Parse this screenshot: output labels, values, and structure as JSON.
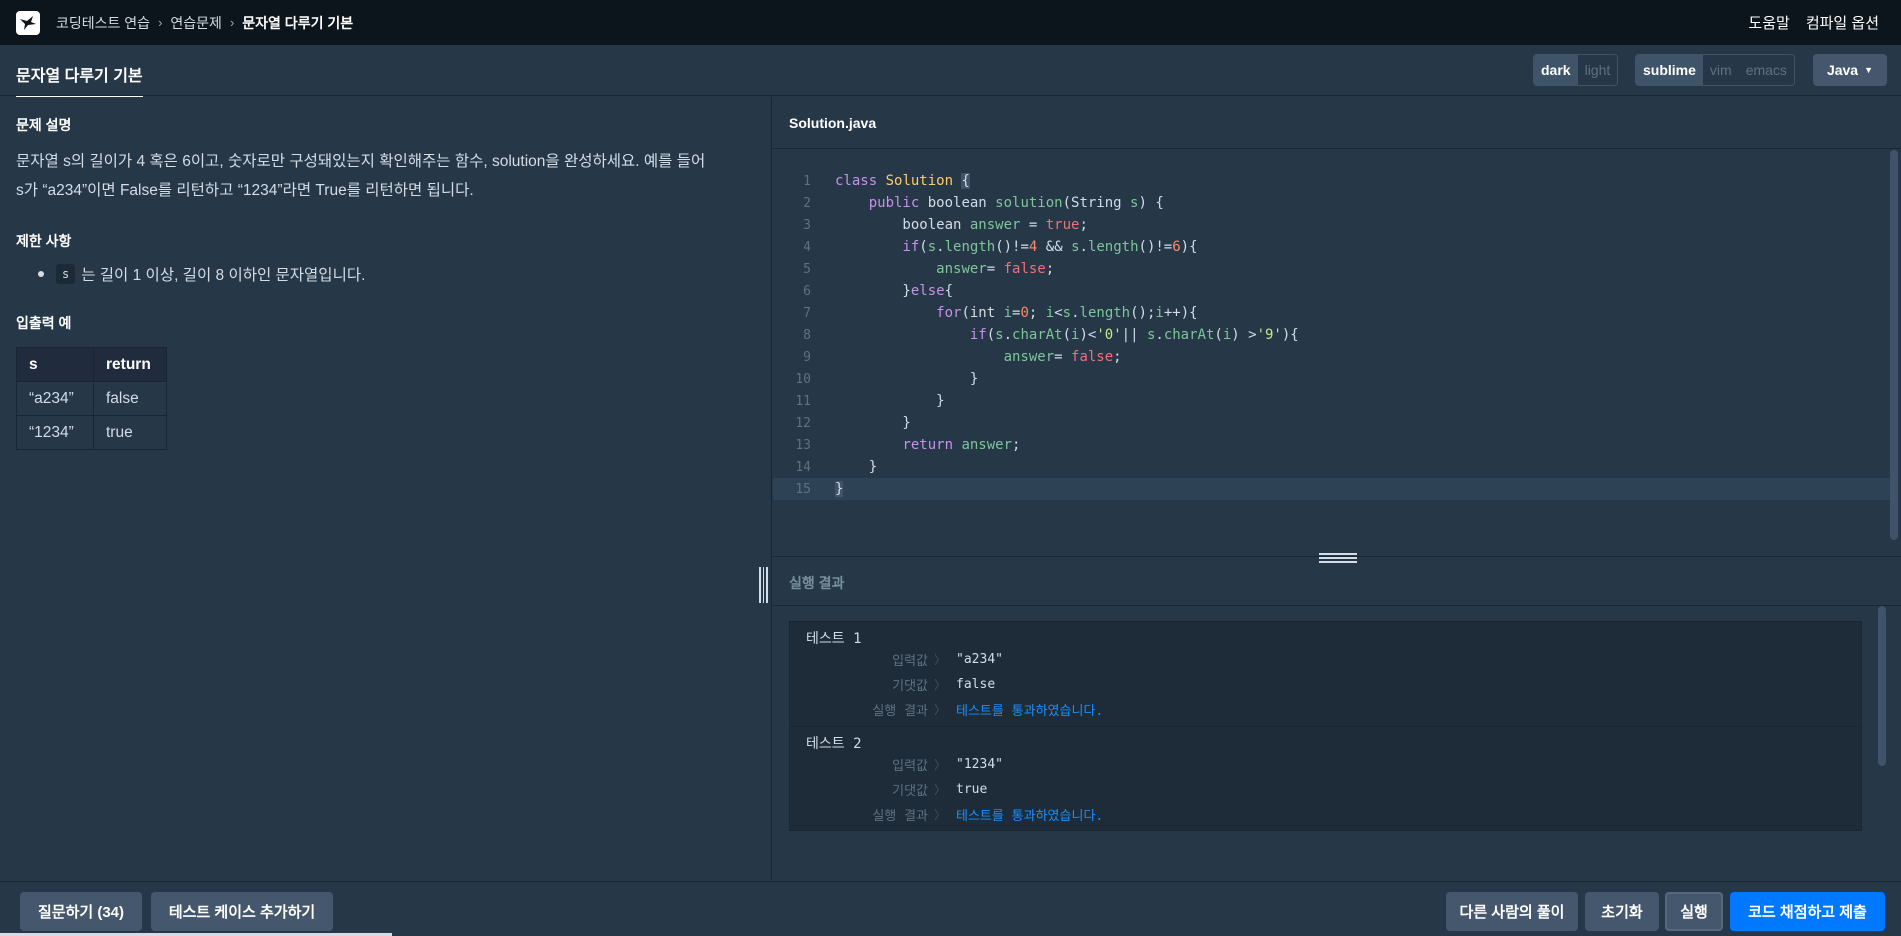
{
  "nav": {
    "breadcrumb": [
      "코딩테스트 연습",
      "연습문제",
      "문자열 다루기 기본"
    ],
    "help": "도움말",
    "compile_options": "컴파일 옵션"
  },
  "header": {
    "tab_title": "문자열 다루기 기본",
    "themes": [
      "dark",
      "light"
    ],
    "keymaps": [
      "sublime",
      "vim",
      "emacs"
    ],
    "language": "Java"
  },
  "problem": {
    "desc_heading": "문제 설명",
    "desc_line1": "문자열 s의 길이가 4 혹은 6이고, 숫자로만 구성돼있는지 확인해주는 함수, solution을 완성하세요. 예를 들어",
    "desc_line2": "s가 “a234”이면 False를 리턴하고 “1234”라면 True를 리턴하면 됩니다.",
    "constraints_heading": "제한 사항",
    "constraint_code": "s",
    "constraint_text": "는 길이 1 이상, 길이 8 이하인 문자열입니다.",
    "io_heading": "입출력 예",
    "io_headers": [
      "s",
      "return"
    ],
    "io_rows": [
      [
        "“a234”",
        "false"
      ],
      [
        "“1234”",
        "true"
      ]
    ]
  },
  "editor": {
    "filename": "Solution.java",
    "line_numbers": [
      "1",
      "2",
      "3",
      "4",
      "5",
      "6",
      "7",
      "8",
      "9",
      "10",
      "11",
      "12",
      "13",
      "14",
      "15"
    ]
  },
  "result": {
    "heading": "실행 결과",
    "tests": [
      {
        "name": "테스트 1",
        "input_label": "입력값",
        "input": "\"a234\"",
        "expected_label": "기댓값",
        "expected": "false",
        "result_label": "실행 결과",
        "result": "테스트를 통과하였습니다."
      },
      {
        "name": "테스트 2",
        "input_label": "입력값",
        "input": "\"1234\"",
        "expected_label": "기댓값",
        "expected": "true",
        "result_label": "실행 결과",
        "result": "테스트를 통과하였습니다."
      }
    ]
  },
  "footer": {
    "ask": "질문하기 (34)",
    "add_testcase": "테스트 케이스 추가하기",
    "others_solutions": "다른 사람의 풀이",
    "reset": "초기화",
    "run": "실행",
    "submit": "코드 채점하고 제출"
  }
}
